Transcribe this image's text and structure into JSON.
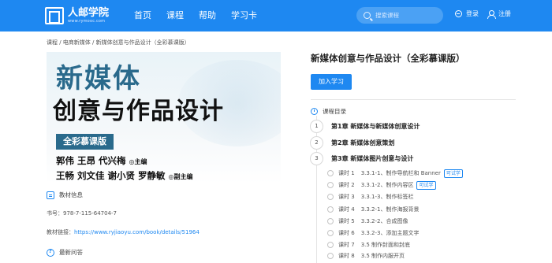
{
  "header": {
    "logo_name": "人邮学院",
    "logo_url": "www.rymooc.com",
    "nav": [
      "首页",
      "课程",
      "帮助",
      "学习卡"
    ],
    "search_placeholder": "搜索课程",
    "login": "登录",
    "register": "注册",
    "colors": {
      "bar": "#1e88f1",
      "search_bg": "#4ba1f4"
    }
  },
  "breadcrumb": "课程 / 电商新媒体 / 新媒体创意与作品设计（全彩慕课版）",
  "cover": {
    "title_line1": "新媒体",
    "title_line2": "创意与作品设计",
    "badge": "全彩慕课版",
    "authors_line1": "郭伟  王昂  代兴梅",
    "role1": "◎主编",
    "authors_line2": "王畅  刘文佳  谢小贤  罗静敏",
    "role2": "◎副主编"
  },
  "book_info": {
    "heading": "教材信息",
    "isbn": "书号：978-7-115-64704-7",
    "link_label": "教材链接：",
    "link_url": "https://www.ryjiaoyu.com/book/details/51964"
  },
  "qa": {
    "heading": "最新问答"
  },
  "course": {
    "title": "新媒体创意与作品设计（全彩慕课版）",
    "join_button": "加入学习",
    "toc_heading": "课程目录",
    "chapters": [
      {
        "num": "1",
        "label": "第1章 新媒体与新媒体创意设计"
      },
      {
        "num": "2",
        "label": "第2章 新媒体创意策划"
      },
      {
        "num": "3",
        "label": "第3章 新媒体图片创意与设计"
      }
    ],
    "lessons": [
      {
        "index": "课时 1",
        "name": "3.3.1-1、制作导航栏和 Banner",
        "trial": "可试学"
      },
      {
        "index": "课时 2",
        "name": "3.3.1-2、制作内容区",
        "trial": "可试学"
      },
      {
        "index": "课时 3",
        "name": "3.3.1-3、制作标签栏",
        "trial": ""
      },
      {
        "index": "课时 4",
        "name": "3.3.2-1、制作海报背景",
        "trial": ""
      },
      {
        "index": "课时 5",
        "name": "3.3.2-2、合成图像",
        "trial": ""
      },
      {
        "index": "课时 6",
        "name": "3.3.2-3、添加主题文字",
        "trial": ""
      },
      {
        "index": "课时 7",
        "name": "3.5 制作封面和封底",
        "trial": ""
      },
      {
        "index": "课时 8",
        "name": "3.5 制作内服开页",
        "trial": ""
      }
    ]
  }
}
